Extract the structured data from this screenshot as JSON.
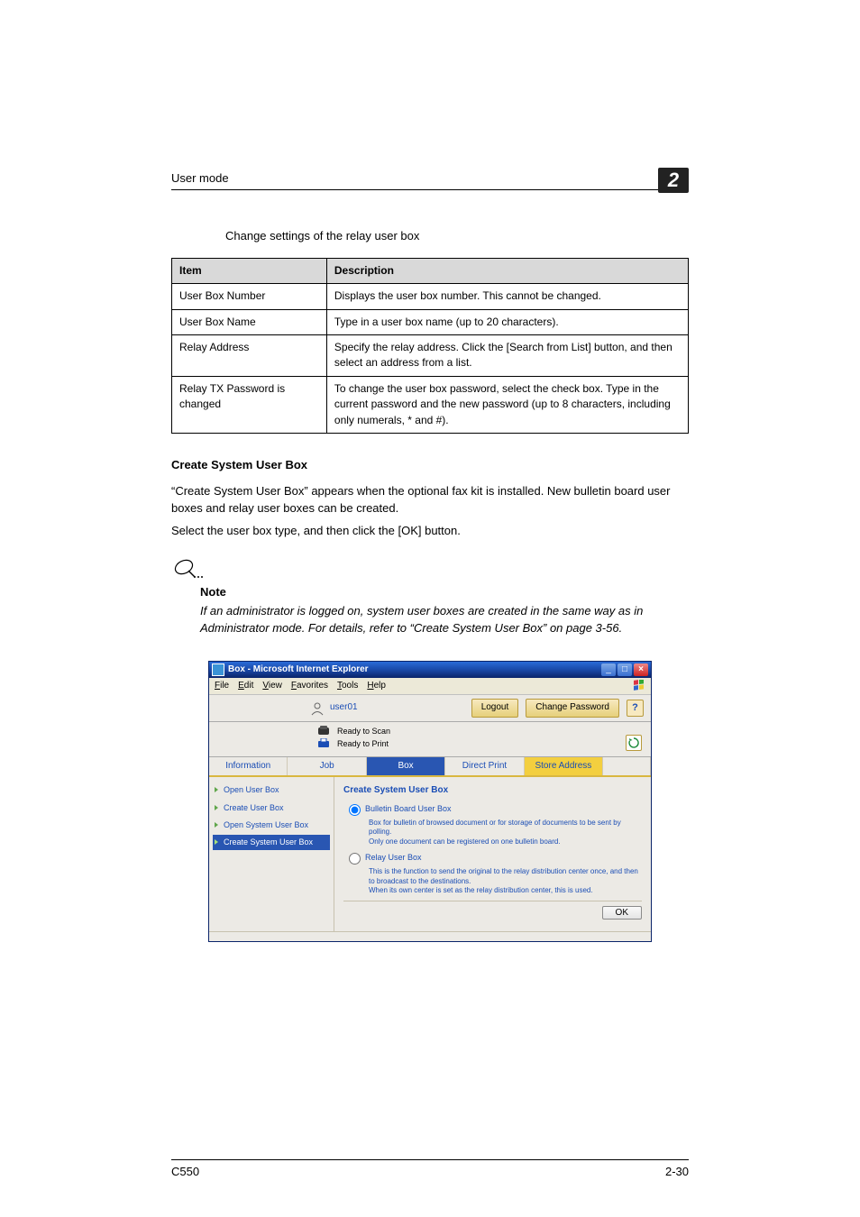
{
  "header": {
    "title": "User mode",
    "chapter": "2"
  },
  "subheading": "Change settings of the relay user box",
  "table": {
    "headers": [
      "Item",
      "Description"
    ],
    "rows": [
      [
        "User Box Number",
        "Displays the user box number. This cannot be changed."
      ],
      [
        "User Box Name",
        "Type in a user box name (up to 20 characters)."
      ],
      [
        "Relay Address",
        "Specify the relay address. Click the [Search from List] button, and then select an address from a list."
      ],
      [
        "Relay TX Password is changed",
        "To change the user box password, select the check box. Type in the current password and the new password (up to 8 characters, including only numerals, * and #)."
      ]
    ]
  },
  "section_heading": "Create System User Box",
  "para1": "“Create System User Box” appears when the optional fax kit is installed. New bulletin board user boxes and relay user boxes can be created.",
  "para2": "Select the user box type, and then click the [OK] button.",
  "note": {
    "label": "Note",
    "text": "If an administrator is logged on, system user boxes are created in the same way as in Administrator mode. For details, refer to “Create System User Box” on page 3-56."
  },
  "ie": {
    "title": "Box - Microsoft Internet Explorer",
    "menus": [
      "File",
      "Edit",
      "View",
      "Favorites",
      "Tools",
      "Help"
    ],
    "user": "user01",
    "logout": "Logout",
    "change_password": "Change Password",
    "status_scan": "Ready to Scan",
    "status_print": "Ready to Print",
    "tabs": [
      "Information",
      "Job",
      "Box",
      "Direct Print",
      "Store Address"
    ],
    "sidebar": [
      "Open User Box",
      "Create User Box",
      "Open System User Box",
      "Create System User Box"
    ],
    "main_heading": "Create System User Box",
    "radio1_label": "Bulletin Board User Box",
    "radio1_desc": "Box for bulletin of browsed document or for storage of documents to be sent by polling.\nOnly one document can be registered on one bulletin board.",
    "radio2_label": "Relay User Box",
    "radio2_desc": "This is the function to send the original to the relay distribution center once, and then to broadcast to the destinations.\nWhen its own center is set as the relay distribution center, this is used.",
    "ok": "OK"
  },
  "footer": {
    "left": "C550",
    "right": "2-30"
  }
}
